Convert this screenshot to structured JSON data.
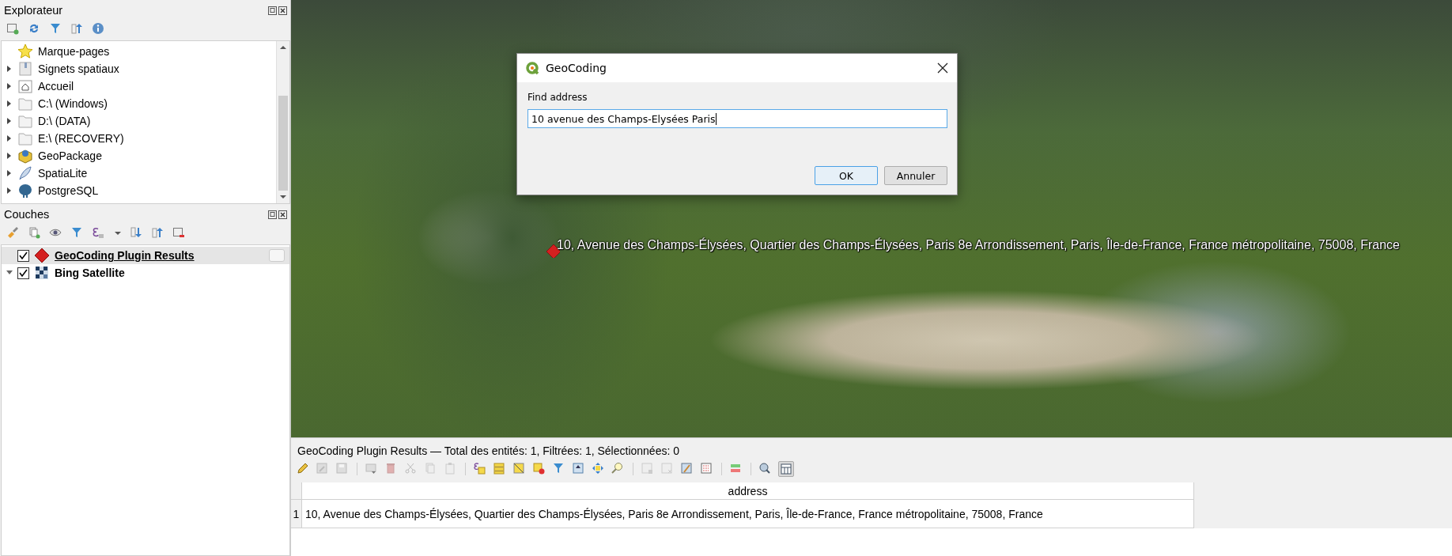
{
  "explorer": {
    "title": "Explorateur",
    "items": [
      {
        "label": "Marque-pages",
        "kind": "bookmarks",
        "expandable": false
      },
      {
        "label": "Signets spatiaux",
        "kind": "spatial-bookmarks",
        "expandable": true
      },
      {
        "label": "Accueil",
        "kind": "home",
        "expandable": true
      },
      {
        "label": "C:\\ (Windows)",
        "kind": "drive",
        "expandable": true
      },
      {
        "label": "D:\\ (DATA)",
        "kind": "drive",
        "expandable": true
      },
      {
        "label": "E:\\ (RECOVERY)",
        "kind": "drive",
        "expandable": true
      },
      {
        "label": "GeoPackage",
        "kind": "geopackage",
        "expandable": true
      },
      {
        "label": "SpatiaLite",
        "kind": "spatialite",
        "expandable": true
      },
      {
        "label": "PostgreSQL",
        "kind": "postgresql",
        "expandable": true
      }
    ]
  },
  "layers": {
    "title": "Couches",
    "items": [
      {
        "label": "GeoCoding Plugin Results",
        "kind": "point",
        "checked": true,
        "selected": true,
        "expandable": false,
        "expanded": false
      },
      {
        "label": "Bing Satellite",
        "kind": "raster",
        "checked": true,
        "selected": false,
        "expandable": true,
        "expanded": true
      }
    ]
  },
  "map": {
    "label": "10, Avenue des Champs-Élysées, Quartier des Champs-Élysées, Paris 8e Arrondissement, Paris, Île-de-France, France métropolitaine, 75008, France"
  },
  "dialog": {
    "title": "GeoCoding",
    "field_label": "Find address",
    "value": "10 avenue des Champs-Elysées Paris",
    "buttons": [
      {
        "label": "OK",
        "default": true
      },
      {
        "label": "Annuler",
        "default": false
      }
    ]
  },
  "attribute_table": {
    "title": "GeoCoding Plugin Results — Total des entités: 1, Filtrées: 1, Sélectionnées: 0",
    "columns": [
      "address"
    ],
    "rows": [
      {
        "number": "1",
        "cells": [
          "10, Avenue des Champs-Élysées, Quartier des Champs-Élysées, Paris 8e Arrondissement, Paris, Île-de-France, France métropolitaine, 75008, France"
        ]
      }
    ]
  }
}
